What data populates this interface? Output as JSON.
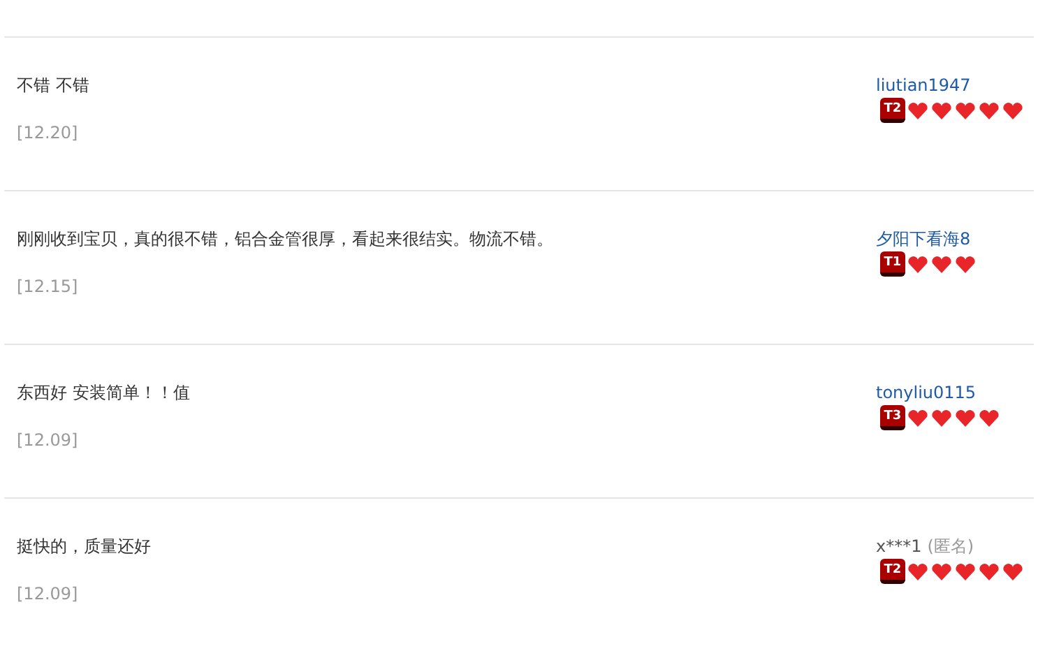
{
  "reviews": [
    {
      "comment": "不错 不错",
      "date": "[12.20]",
      "user": {
        "name": "liutian1947",
        "kind": "member",
        "badge": "T2"
      },
      "stars": 5
    },
    {
      "comment": "刚刚收到宝贝，真的很不错，铝合金管很厚，看起来很结实。物流不错。",
      "date": "[12.15]",
      "user": {
        "name": "夕阳下看海8",
        "kind": "member",
        "badge": "T1"
      },
      "stars": 3
    },
    {
      "comment": "东西好 安装简单！！值",
      "date": "[12.09]",
      "user": {
        "name": "tonyliu0115",
        "kind": "member",
        "badge": "T3"
      },
      "stars": 4
    },
    {
      "comment": "挺快的，质量还好",
      "date": "[12.09]",
      "user": {
        "name": "x***1",
        "kind": "anonymous",
        "tag": "(匿名)",
        "badge": "T2"
      },
      "stars": 5
    }
  ]
}
